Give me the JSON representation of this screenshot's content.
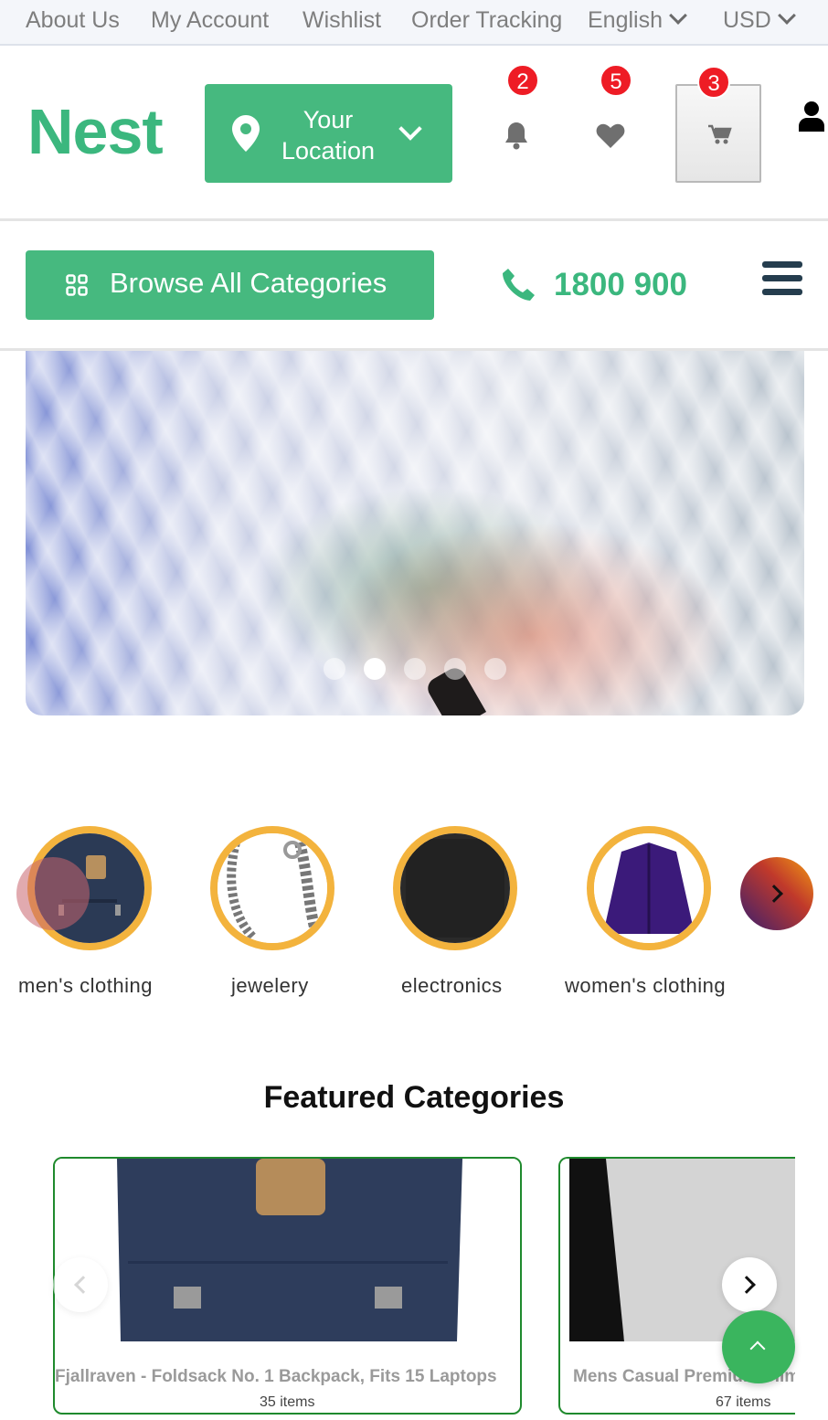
{
  "topbar": {
    "links": [
      "About Us",
      "My Account",
      "Wishlist",
      "Order Tracking"
    ],
    "language": "English",
    "currency": "USD"
  },
  "header": {
    "logo": "Nest",
    "location_label": "Your Location",
    "location_line1": "Your",
    "location_line2": "Location",
    "notifications_count": "2",
    "wishlist_count": "5",
    "cart_count": "3"
  },
  "nav": {
    "browse_label": "Browse All Categories",
    "phone": "1800 900"
  },
  "hero": {
    "slide_count": 5,
    "active_slide": 2
  },
  "categories": [
    {
      "label": "men's clothing"
    },
    {
      "label": "jewelery"
    },
    {
      "label": "electronics"
    },
    {
      "label": "women's clothing"
    }
  ],
  "featured": {
    "title": "Featured Categories",
    "cards": [
      {
        "name": "Fjallraven - Foldsack No. 1 Backpack, Fits 15 Laptops",
        "count": "35 items"
      },
      {
        "name": "Mens Casual Premium Slim",
        "count": "67 items"
      }
    ]
  },
  "colors": {
    "brand_green": "#3bb77e",
    "badge_red": "#ee1c25",
    "ring_orange": "#f3b33d",
    "card_border": "#1f8a2d"
  },
  "icons": [
    "map-pin-icon",
    "bell-icon",
    "heart-icon",
    "cart-icon",
    "user-icon",
    "grid-icon",
    "phone-icon",
    "menu-icon"
  ]
}
